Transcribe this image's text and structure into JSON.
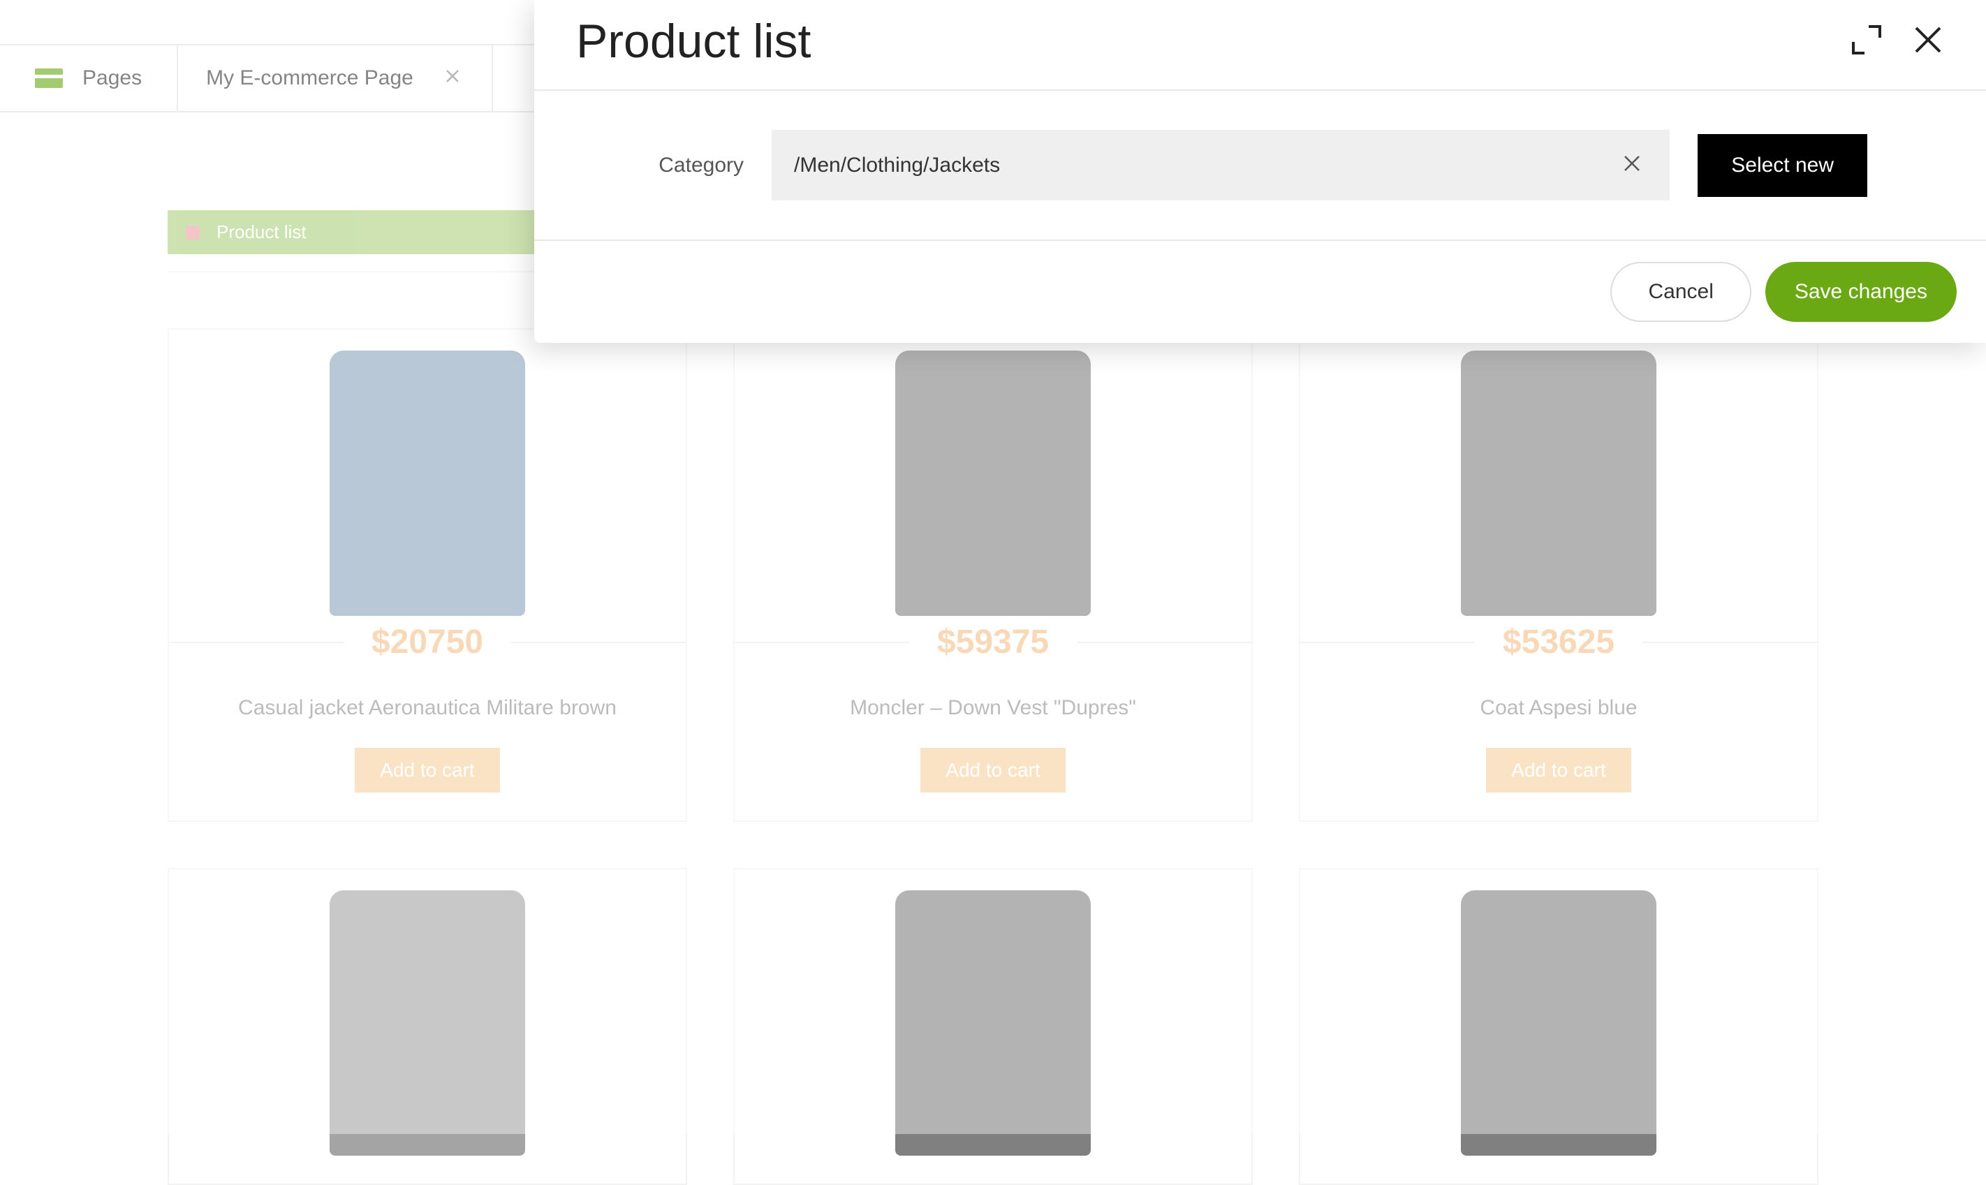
{
  "tabs": {
    "pages_label": "Pages",
    "active_tab": "My E-commerce Page"
  },
  "page": {
    "section_label": "Product list",
    "products": [
      {
        "price": "$20750",
        "name": "Casual jacket Aeronautica Militare brown",
        "cta": "Add to cart",
        "color": "blue"
      },
      {
        "price": "$59375",
        "name": "Moncler – Down Vest \"Dupres\"",
        "cta": "Add to cart",
        "color": "black"
      },
      {
        "price": "$53625",
        "name": "Coat Aspesi blue",
        "cta": "Add to cart",
        "color": "black"
      },
      {
        "price": "",
        "name": "",
        "cta": "",
        "color": "grey"
      },
      {
        "price": "",
        "name": "",
        "cta": "",
        "color": "black"
      },
      {
        "price": "",
        "name": "",
        "cta": "",
        "color": "black"
      }
    ]
  },
  "modal": {
    "title": "Product list",
    "category_label": "Category",
    "category_value": "/Men/Clothing/Jackets",
    "select_new": "Select new",
    "cancel": "Cancel",
    "save": "Save changes"
  }
}
